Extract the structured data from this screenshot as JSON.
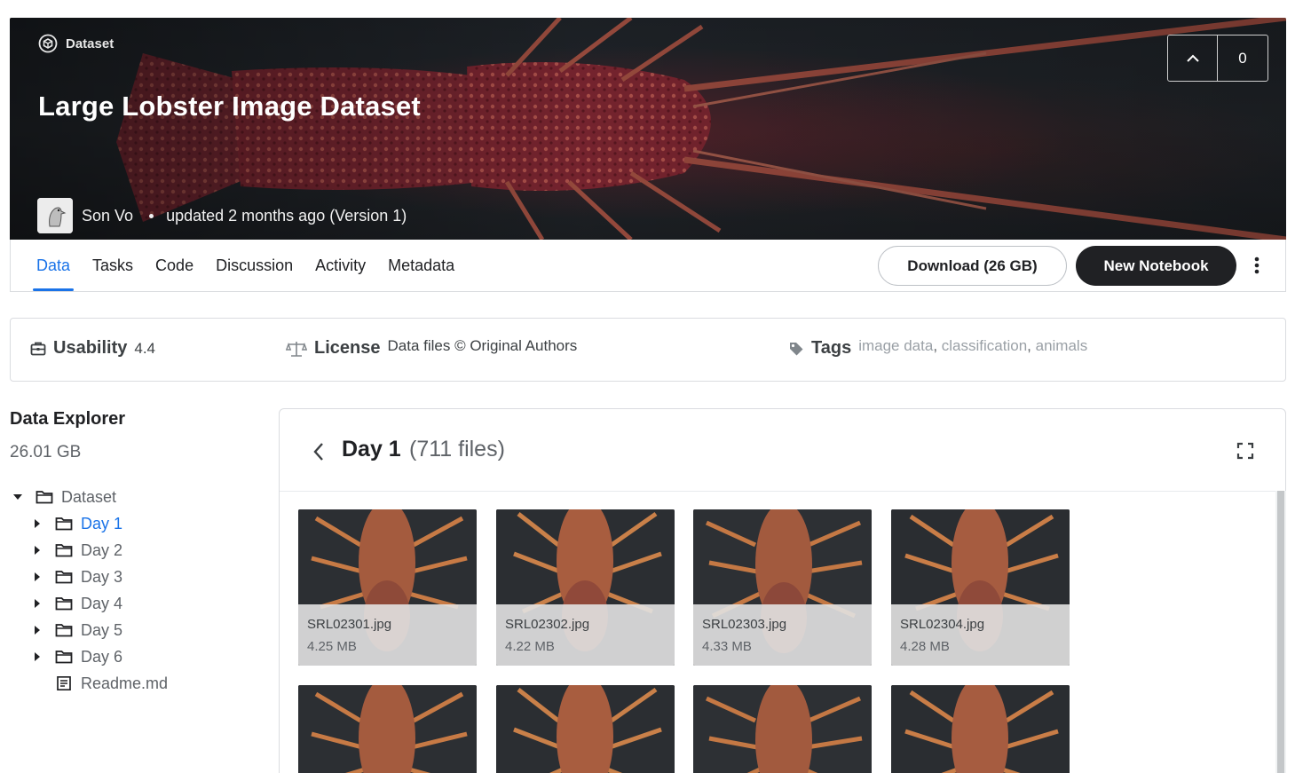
{
  "header": {
    "badge": "Dataset",
    "title": "Large Lobster Image Dataset",
    "author": "Son Vo",
    "updated": "updated 2 months ago (Version 1)",
    "vote_count": "0"
  },
  "tabs": [
    {
      "label": "Data",
      "active": true
    },
    {
      "label": "Tasks"
    },
    {
      "label": "Code"
    },
    {
      "label": "Discussion"
    },
    {
      "label": "Activity"
    },
    {
      "label": "Metadata"
    }
  ],
  "actions": {
    "download": "Download (26 GB)",
    "new_notebook": "New Notebook"
  },
  "info": {
    "usability_label": "Usability",
    "usability_value": "4.4",
    "license_label": "License",
    "license_value": "Data files © Original Authors",
    "tags_label": "Tags",
    "tags": [
      "image data",
      "classification",
      "animals"
    ]
  },
  "explorer": {
    "title": "Data Explorer",
    "size": "26.01 GB",
    "root": "Dataset",
    "folders": [
      "Day 1",
      "Day 2",
      "Day 3",
      "Day 4",
      "Day 5",
      "Day 6"
    ],
    "selected_folder": "Day 1",
    "readme": "Readme.md"
  },
  "panel": {
    "folder": "Day 1",
    "count": "(711 files)",
    "files": [
      {
        "name": "SRL02301.jpg",
        "size": "4.25 MB"
      },
      {
        "name": "SRL02302.jpg",
        "size": "4.22 MB"
      },
      {
        "name": "SRL02303.jpg",
        "size": "4.33 MB"
      },
      {
        "name": "SRL02304.jpg",
        "size": "4.28 MB"
      }
    ]
  },
  "colors": {
    "accent": "#1a73e8",
    "dark_button": "#202124",
    "lobster": "#8a2f38"
  },
  "icons": [
    "dataset-icon",
    "chevron-up-icon",
    "more-vert-icon",
    "usability-icon",
    "license-scale-icon",
    "tag-icon",
    "caret-down-icon",
    "caret-right-icon",
    "folder-icon",
    "document-icon",
    "chevron-left-icon",
    "fullscreen-icon"
  ]
}
